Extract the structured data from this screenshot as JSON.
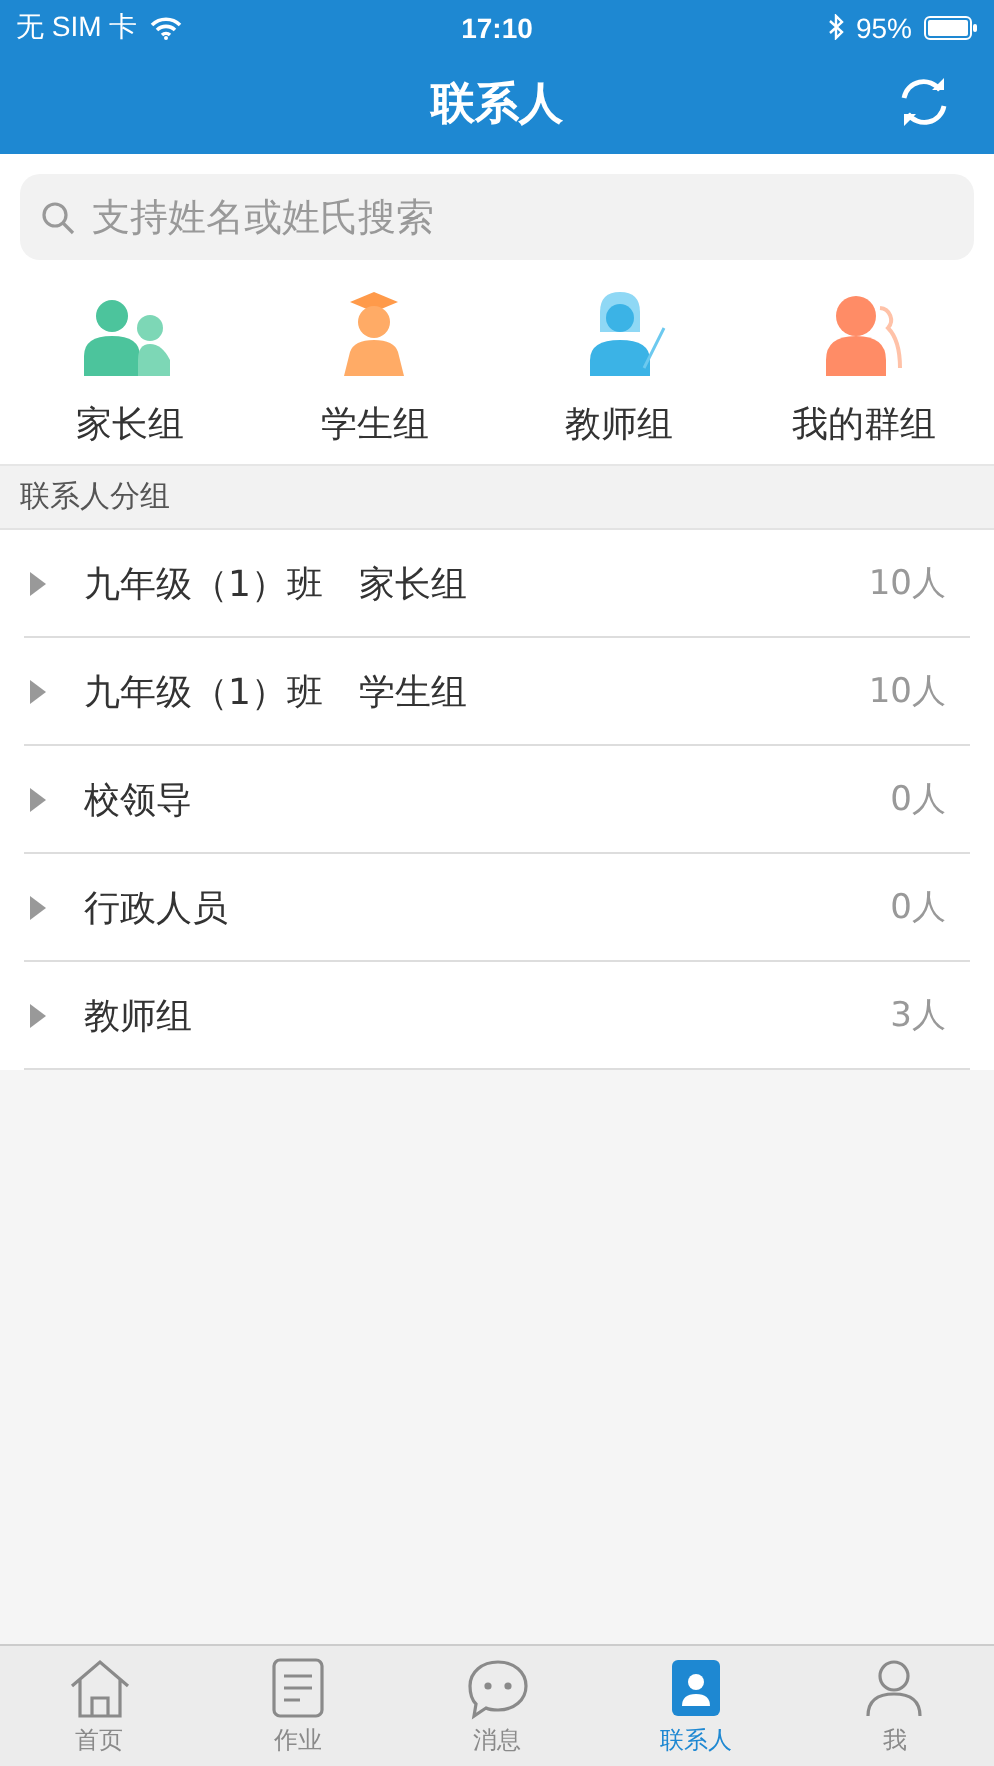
{
  "status_bar": {
    "carrier": "无 SIM 卡",
    "time": "17:10",
    "battery": "95%"
  },
  "header": {
    "title": "联系人"
  },
  "search": {
    "placeholder": "支持姓名或姓氏搜索"
  },
  "quick_groups": [
    {
      "label": "家长组",
      "kind": "parents"
    },
    {
      "label": "学生组",
      "kind": "student"
    },
    {
      "label": "教师组",
      "kind": "teacher"
    },
    {
      "label": "我的群组",
      "kind": "mygroup"
    }
  ],
  "section_title": "联系人分组",
  "groups": [
    {
      "name": "九年级（1）班　家长组",
      "count": "10人",
      "expanded": false
    },
    {
      "name": "九年级（1）班　学生组",
      "count": "10人",
      "expanded": false
    },
    {
      "name": "校领导",
      "count": "0人",
      "expanded": false
    },
    {
      "name": "行政人员",
      "count": "0人",
      "expanded": false
    },
    {
      "name": "教师组",
      "count": "3人",
      "expanded": false
    }
  ],
  "tabs": [
    {
      "label": "首页",
      "kind": "home",
      "selected": false
    },
    {
      "label": "作业",
      "kind": "homework",
      "selected": false
    },
    {
      "label": "消息",
      "kind": "message",
      "selected": false
    },
    {
      "label": "联系人",
      "kind": "contacts",
      "selected": true
    },
    {
      "label": "我",
      "kind": "me",
      "selected": false
    }
  ]
}
